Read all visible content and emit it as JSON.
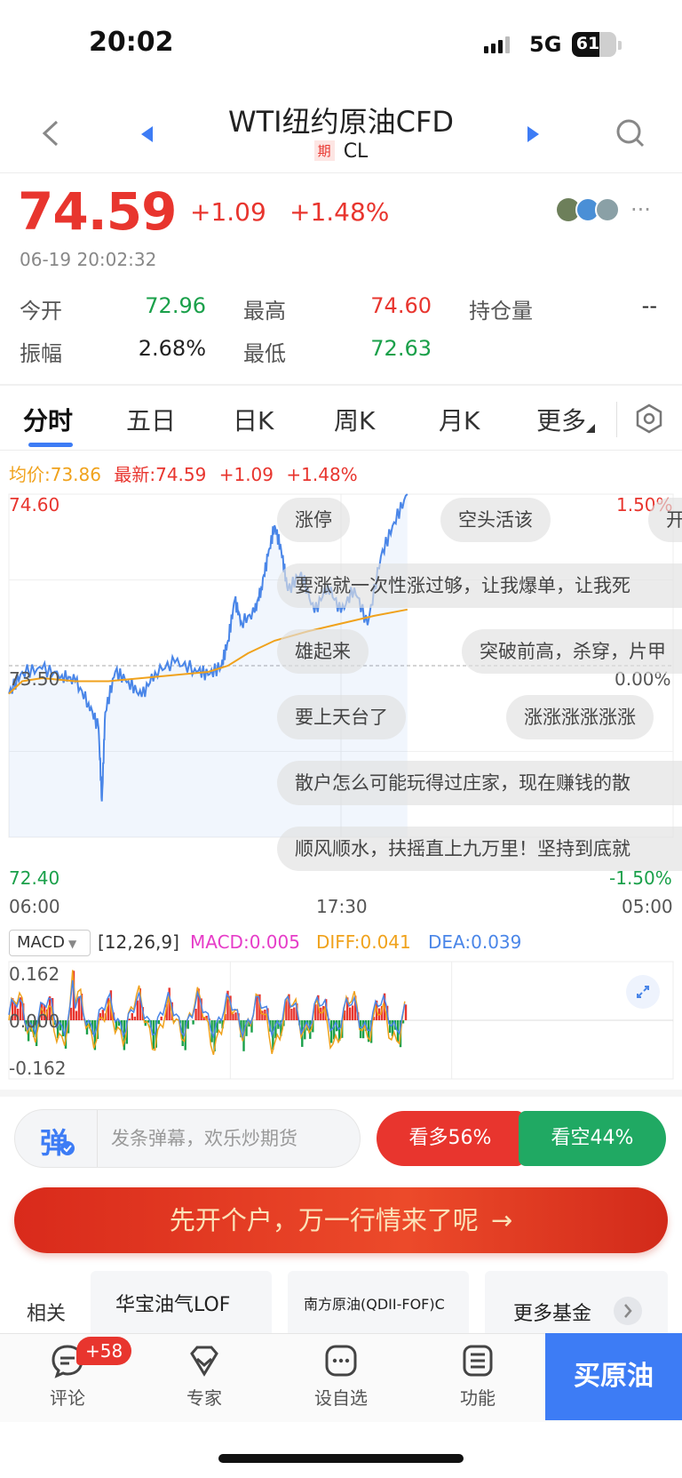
{
  "status_bar": {
    "time": "20:02",
    "network": "5G",
    "battery": "61"
  },
  "header": {
    "title": "WTI纽约原油CFD",
    "tag": "期",
    "symbol": "CL"
  },
  "quote": {
    "price": "74.59",
    "change": "+1.09",
    "change_pct": "+1.48%",
    "timestamp": "06-19 20:02:32",
    "stats": [
      {
        "label": "今开",
        "value": "72.96",
        "color": "green"
      },
      {
        "label": "最高",
        "value": "74.60",
        "color": "red"
      },
      {
        "label": "持仓量",
        "value": "--",
        "color": "dark"
      },
      {
        "label": "振幅",
        "value": "2.68%",
        "color": "dark"
      },
      {
        "label": "最低",
        "value": "72.63",
        "color": "green"
      }
    ]
  },
  "tabs": [
    "分时",
    "五日",
    "日K",
    "周K",
    "月K",
    "更多"
  ],
  "legend": {
    "avg": "均价:73.86",
    "latest": "最新:74.59",
    "chg": "+1.09",
    "pct": "+1.48%"
  },
  "chart_labels": {
    "y_top": "74.60",
    "y_mid": "73.50",
    "y_bot": "72.40",
    "pct_top": "1.50%",
    "pct_mid": "0.00%",
    "pct_bot": "-1.50%",
    "x": [
      "06:00",
      "17:30",
      "05:00"
    ]
  },
  "chart_data": [
    {
      "type": "line",
      "title": "",
      "x_labels": [
        "06:00",
        "17:30",
        "05:00"
      ],
      "ylim": [
        72.4,
        74.6
      ],
      "series": [
        {
          "name": "最新",
          "color": "#4a86e8",
          "points": [
            [
              0,
              73.32
            ],
            [
              0.02,
              73.46
            ],
            [
              0.05,
              73.48
            ],
            [
              0.08,
              73.44
            ],
            [
              0.1,
              73.4
            ],
            [
              0.12,
              73.26
            ],
            [
              0.135,
              73.1
            ],
            [
              0.14,
              72.63
            ],
            [
              0.145,
              73.2
            ],
            [
              0.16,
              73.46
            ],
            [
              0.18,
              73.4
            ],
            [
              0.2,
              73.3
            ],
            [
              0.22,
              73.46
            ],
            [
              0.25,
              73.52
            ],
            [
              0.28,
              73.48
            ],
            [
              0.3,
              73.44
            ],
            [
              0.32,
              73.5
            ],
            [
              0.33,
              73.66
            ],
            [
              0.34,
              73.92
            ],
            [
              0.35,
              73.78
            ],
            [
              0.37,
              73.84
            ],
            [
              0.38,
              74.0
            ],
            [
              0.39,
              74.2
            ],
            [
              0.4,
              74.4
            ],
            [
              0.41,
              74.24
            ],
            [
              0.42,
              73.98
            ],
            [
              0.44,
              74.1
            ],
            [
              0.46,
              73.84
            ],
            [
              0.48,
              74.02
            ],
            [
              0.5,
              73.84
            ],
            [
              0.52,
              74.0
            ],
            [
              0.54,
              73.76
            ],
            [
              0.56,
              74.2
            ],
            [
              0.58,
              74.42
            ],
            [
              0.6,
              74.6
            ]
          ]
        },
        {
          "name": "均价",
          "color": "#f0a21c",
          "points": [
            [
              0,
              73.32
            ],
            [
              0.02,
              73.4
            ],
            [
              0.05,
              73.42
            ],
            [
              0.1,
              73.4
            ],
            [
              0.15,
              73.4
            ],
            [
              0.2,
              73.42
            ],
            [
              0.25,
              73.44
            ],
            [
              0.3,
              73.46
            ],
            [
              0.33,
              73.5
            ],
            [
              0.36,
              73.58
            ],
            [
              0.4,
              73.66
            ],
            [
              0.45,
              73.72
            ],
            [
              0.5,
              73.77
            ],
            [
              0.55,
              73.82
            ],
            [
              0.6,
              73.86
            ]
          ]
        }
      ]
    },
    {
      "type": "bar",
      "title": "MACD",
      "params": "[12,26,9]",
      "ylim": [
        -0.162,
        0.162
      ],
      "values": {
        "MACD": 0.005,
        "DIFF": 0.041,
        "DEA": 0.039
      }
    }
  ],
  "danmu": [
    "涨停",
    "空头活该",
    "开",
    "要涨就一次性涨过够，让我爆单，让我死",
    "雄起来",
    "突破前高，杀穿，片甲",
    "要上天台了",
    "涨涨涨涨涨涨",
    "散户怎么可能玩得过庄家，现在赚钱的散",
    "顺风顺水，扶摇直上九万里！坚持到底就"
  ],
  "macd": {
    "selector": "MACD",
    "params": "[12,26,9]",
    "macd": "MACD:0.005",
    "diff": "DIFF:0.041",
    "dea": "DEA:0.039",
    "y_top": "0.162",
    "y_mid": "0.000",
    "y_bot": "-0.162"
  },
  "controls": {
    "danmu_icon": "弹",
    "danmu_placeholder": "发条弹幕，欢乐炒期货",
    "bull": "看多56%",
    "bear": "看空44%",
    "bull_ratio": 0.56,
    "promo": "先开个户，万一行情来了呢"
  },
  "funds": {
    "label": "相关基金",
    "items": [
      "华宝油气LOF",
      "南方原油(QDII-FOF)C",
      "更多基金"
    ]
  },
  "nav": {
    "badge": "+58",
    "items": [
      "评论",
      "专家",
      "设自选",
      "功能"
    ],
    "buy": "买原油"
  },
  "colors": {
    "up": "#e8352e",
    "down": "#1aa04a",
    "accent": "#3d7cf5",
    "avg": "#f0a21c"
  }
}
